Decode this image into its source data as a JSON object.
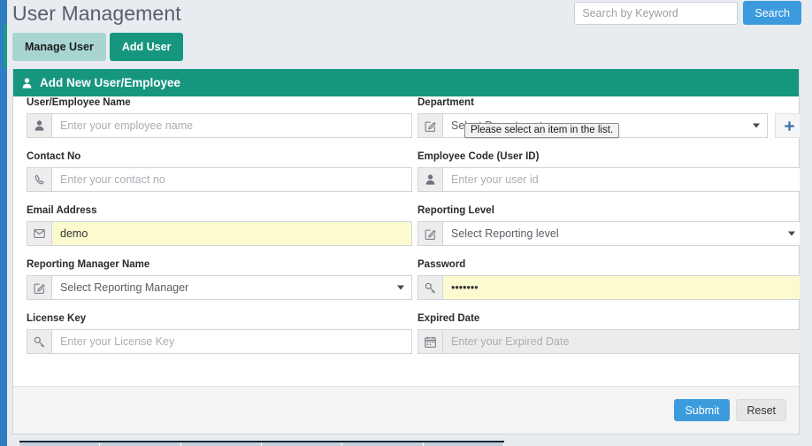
{
  "header": {
    "title": "User Management",
    "search": {
      "placeholder": "Search by Keyword",
      "value": "",
      "button_label": "Search",
      "button_color": "#3c9bdd"
    }
  },
  "tabs": [
    {
      "label": "Manage User",
      "active": false,
      "color": "#a8d5cf"
    },
    {
      "label": "Add User",
      "active": true,
      "color": "#17967f"
    }
  ],
  "panel": {
    "title": "Add New User/Employee",
    "icon": "user-icon",
    "accent_color": "#17967f"
  },
  "tooltip": {
    "text": "Please select an item in the list."
  },
  "form": {
    "left": [
      {
        "label": "User/Employee Name",
        "icon": "user-icon",
        "type": "text",
        "placeholder": "Enter your employee name",
        "value": "",
        "state": "normal"
      },
      {
        "label": "Contact No",
        "icon": "phone-icon",
        "type": "text",
        "placeholder": "Enter your contact no",
        "value": "",
        "state": "normal"
      },
      {
        "label": "Email Address",
        "icon": "envelope-icon",
        "type": "text",
        "placeholder": "",
        "value": "demo",
        "state": "warn"
      },
      {
        "label": "Reporting Manager Name",
        "icon": "pencil-square-icon",
        "type": "select",
        "value": "Select Reporting Manager",
        "state": "normal"
      },
      {
        "label": "License Key",
        "icon": "key-icon",
        "type": "text",
        "placeholder": "Enter your License Key",
        "value": "",
        "state": "normal"
      }
    ],
    "right": [
      {
        "label": "Department",
        "icon": "pencil-square-icon",
        "type": "select",
        "value": "Select Department",
        "state": "normal",
        "add_button": "+"
      },
      {
        "label": "Employee Code (User ID)",
        "icon": "user-icon",
        "type": "text",
        "placeholder": "Enter your user id",
        "value": "",
        "state": "normal"
      },
      {
        "label": "Reporting Level",
        "icon": "pencil-square-icon",
        "type": "select",
        "value": "Select Reporting level",
        "state": "normal"
      },
      {
        "label": "Password",
        "icon": "key-icon",
        "type": "password",
        "placeholder": "",
        "value": "•••••••",
        "state": "warn"
      },
      {
        "label": "Expired Date",
        "icon": "calendar-icon",
        "type": "text",
        "placeholder": "Enter your Expired Date",
        "value": "",
        "state": "readonly"
      }
    ]
  },
  "footer": {
    "submit_label": "Submit",
    "reset_label": "Reset"
  }
}
